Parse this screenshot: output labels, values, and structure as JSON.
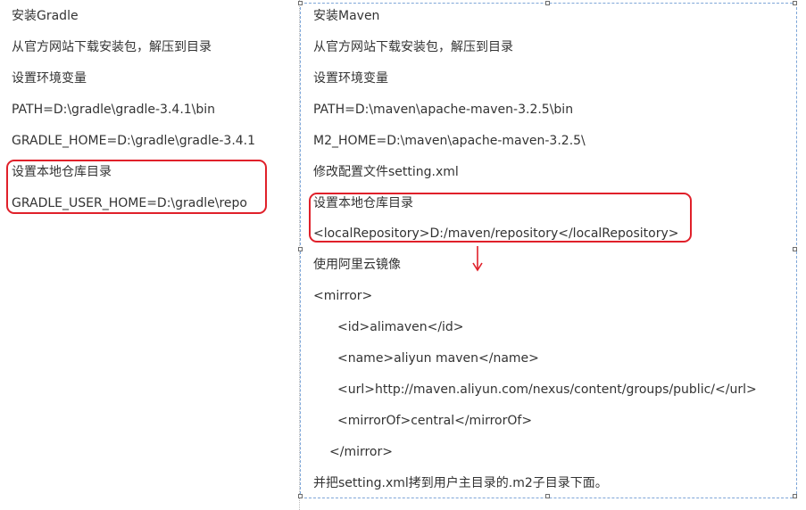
{
  "gradle": {
    "lines": [
      "安装Gradle",
      "从官方网站下载安装包，解压到目录",
      "设置环境变量",
      "PATH=D:\\gradle\\gradle-3.4.1\\bin",
      "GRADLE_HOME=D:\\gradle\\gradle-3.4.1",
      "设置本地仓库目录",
      "GRADLE_USER_HOME=D:\\gradle\\repo"
    ]
  },
  "maven": {
    "lines": [
      "安装Maven",
      "从官方网站下载安装包，解压到目录",
      "设置环境变量",
      "PATH=D:\\maven\\apache-maven-3.2.5\\bin",
      "M2_HOME=D:\\maven\\apache-maven-3.2.5\\",
      "修改配置文件setting.xml",
      "设置本地仓库目录",
      "<localRepository>D:/maven/repository</localRepository>",
      "使用阿里云镜像",
      "<mirror>",
      "<id>alimaven</id>",
      "<name>aliyun maven</name>",
      "<url>http://maven.aliyun.com/nexus/content/groups/public/</url>",
      "<mirrorOf>central</mirrorOf>",
      "</mirror>",
      "并把setting.xml拷到用户主目录的.m2子目录下面。"
    ]
  },
  "colors": {
    "text": "#333333",
    "highlight": "#e0202a",
    "selection": "#7ea6d8"
  }
}
